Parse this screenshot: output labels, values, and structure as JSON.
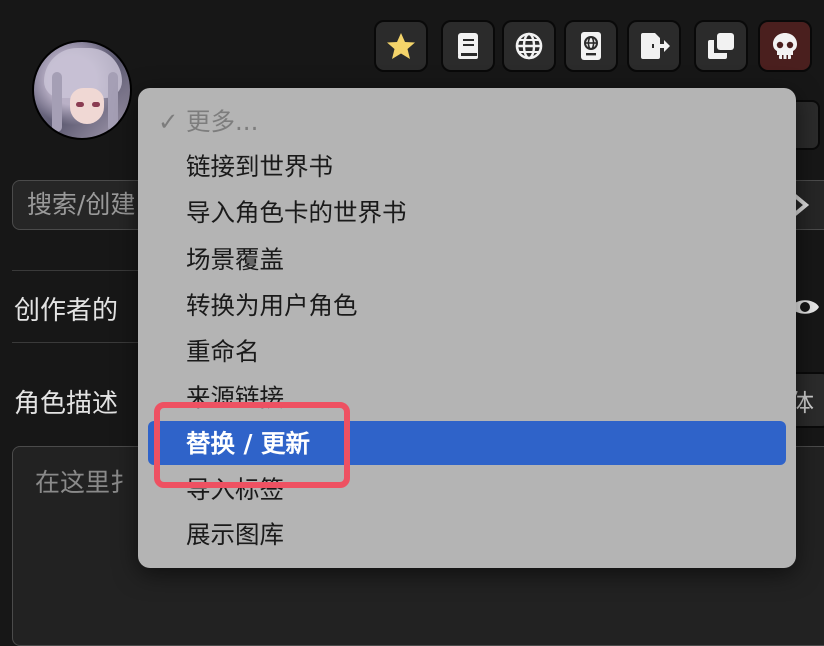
{
  "toolbar": {
    "buttons": [
      {
        "name": "favorite",
        "icon": "star-icon"
      },
      {
        "name": "lore-book",
        "icon": "book-icon"
      },
      {
        "name": "world-info",
        "icon": "globe-icon"
      },
      {
        "name": "character-lore",
        "icon": "passport-icon"
      },
      {
        "name": "export",
        "icon": "export-icon"
      },
      {
        "name": "duplicate",
        "icon": "clone-icon"
      },
      {
        "name": "delete",
        "icon": "skull-icon"
      }
    ],
    "accent_star": "#f4d46a",
    "danger_bg": "#4a1f1e"
  },
  "panel": {
    "search_placeholder": "搜索/创建",
    "creator_notes_label": "创作者的",
    "description_label": "角色描述",
    "textarea_placeholder": "在这里扌",
    "font_toggle": "体"
  },
  "menu": {
    "header": "更多...",
    "checkmark": "✓",
    "items": [
      "链接到世界书",
      "导入角色卡的世界书",
      "场景覆盖",
      "转换为用户角色",
      "重命名",
      "来源链接",
      "替换 / 更新",
      "导入标签",
      "展示图库"
    ],
    "selected_index": 6,
    "highlight_color": "#2f63c9",
    "annotation_color": "#ee5162"
  }
}
